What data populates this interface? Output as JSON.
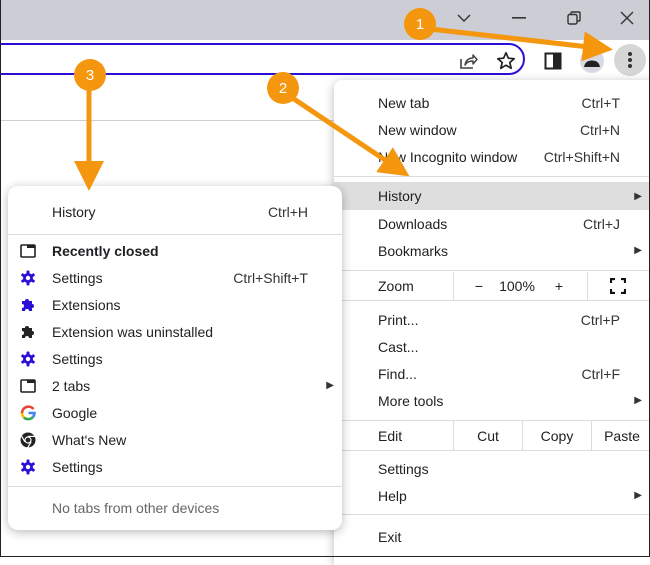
{
  "window": {
    "controls": [
      "tab-search",
      "minimize",
      "restore",
      "close"
    ]
  },
  "toolbar": {
    "icons": [
      "share-icon",
      "bookmark-star-icon",
      "side-panel-icon",
      "profile-avatar-icon",
      "menu-kebab-icon"
    ]
  },
  "main_menu": {
    "items": [
      {
        "label": "New tab",
        "shortcut": "Ctrl+T"
      },
      {
        "label": "New window",
        "shortcut": "Ctrl+N"
      },
      {
        "label": "New Incognito window",
        "shortcut": "Ctrl+Shift+N"
      },
      {
        "label": "History",
        "submenu": true,
        "highlighted": true
      },
      {
        "label": "Downloads",
        "shortcut": "Ctrl+J"
      },
      {
        "label": "Bookmarks",
        "submenu": true
      },
      {
        "label": "Print...",
        "shortcut": "Ctrl+P"
      },
      {
        "label": "Cast..."
      },
      {
        "label": "Find...",
        "shortcut": "Ctrl+F"
      },
      {
        "label": "More tools",
        "submenu": true
      },
      {
        "label": "Settings"
      },
      {
        "label": "Help",
        "submenu": true
      },
      {
        "label": "Exit"
      }
    ],
    "zoom": {
      "label": "Zoom",
      "minus": "−",
      "value": "100%",
      "plus": "+"
    },
    "edit": {
      "label": "Edit",
      "cut": "Cut",
      "copy": "Copy",
      "paste": "Paste"
    }
  },
  "history_menu": {
    "header": {
      "label": "History",
      "shortcut": "Ctrl+H"
    },
    "section_title": "Recently closed",
    "items": [
      {
        "label": "Settings",
        "shortcut": "Ctrl+Shift+T",
        "icon": "settings-gear-icon"
      },
      {
        "label": "Extensions",
        "icon": "extensions-puzzle-icon"
      },
      {
        "label": "Extension was uninstalled",
        "icon": "puzzle-icon"
      },
      {
        "label": "Settings",
        "icon": "settings-gear-icon"
      },
      {
        "label": "2 tabs",
        "icon": "window-icon",
        "submenu": true
      },
      {
        "label": "Google",
        "icon": "google-g-icon"
      },
      {
        "label": "What's New",
        "icon": "chrome-icon"
      },
      {
        "label": "Settings",
        "icon": "settings-gear-icon"
      }
    ],
    "footer": "No tabs from other devices"
  },
  "annotations": {
    "badges": [
      "1",
      "2",
      "3"
    ],
    "color": "#f5960f"
  },
  "colors": {
    "accent": "#2a10d6",
    "highlight": "#dedede",
    "titlebar": "#cdcdd6"
  }
}
